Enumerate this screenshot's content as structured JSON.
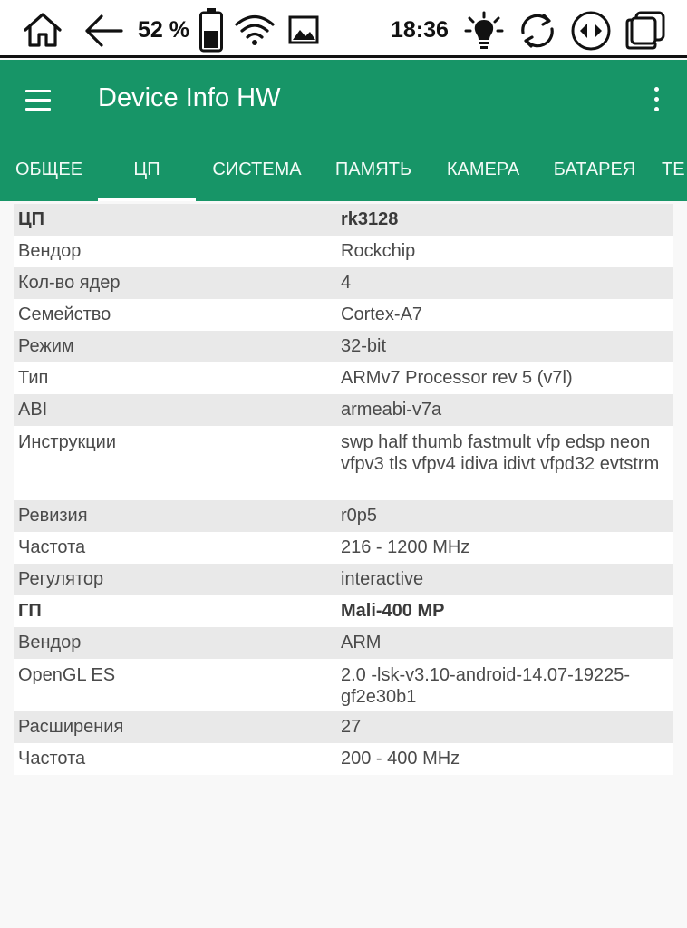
{
  "status_bar": {
    "battery_percent": "52 %",
    "time": "18:36"
  },
  "app_bar": {
    "title": "Device Info HW"
  },
  "tabs": [
    {
      "label": "ОБЩЕЕ",
      "active": false
    },
    {
      "label": "ЦП",
      "active": true
    },
    {
      "label": "СИСТЕМА",
      "active": false
    },
    {
      "label": "ПАМЯТЬ",
      "active": false
    },
    {
      "label": "КАМЕРА",
      "active": false
    },
    {
      "label": "БАТАРЕЯ",
      "active": false
    },
    {
      "label": "ТЕ",
      "active": false
    }
  ],
  "rows": [
    {
      "label": "ЦП",
      "value": "rk3128",
      "header": true
    },
    {
      "label": "Вендор",
      "value": "Rockchip"
    },
    {
      "label": "Кол-во ядер",
      "value": "4"
    },
    {
      "label": "Семейство",
      "value": "Cortex-A7"
    },
    {
      "label": "Режим",
      "value": "32-bit"
    },
    {
      "label": "Тип",
      "value": "ARMv7 Processor rev 5 (v7l)"
    },
    {
      "label": "ABI",
      "value": "armeabi-v7a"
    },
    {
      "label": "Инструкции",
      "value": "swp half thumb fastmult vfp edsp neon vfpv3 tls vfpv4 idiva idivt vfpd32 evtstrm"
    },
    {
      "label": "Ревизия",
      "value": "r0p5"
    },
    {
      "label": "Частота",
      "value": "216 - 1200 MHz"
    },
    {
      "label": "Регулятор",
      "value": "interactive"
    },
    {
      "label": "ГП",
      "value": "Mali-400 MP",
      "header": true
    },
    {
      "label": "Вендор",
      "value": "ARM"
    },
    {
      "label": "OpenGL ES",
      "value": "2.0 -lsk-v3.10-android-14.07-19225-gf2e30b1"
    },
    {
      "label": "Расширения",
      "value": "27"
    },
    {
      "label": "Частота",
      "value": "200 - 400 MHz"
    }
  ],
  "icons": {
    "home": "home-icon",
    "back": "back-arrow-icon",
    "battery": "battery-icon",
    "wifi": "wifi-icon",
    "screenshot": "image-icon",
    "brightness": "lightbulb-icon",
    "refresh": "refresh-icon",
    "rotate": "rotate-icon",
    "window": "window-icon",
    "menu": "menu-icon",
    "overflow": "more-vert-icon"
  },
  "colors": {
    "accent": "#179567",
    "row_shaded": "#e9e9e9",
    "row_plain": "#ffffff",
    "background": "#f8f8f8"
  }
}
